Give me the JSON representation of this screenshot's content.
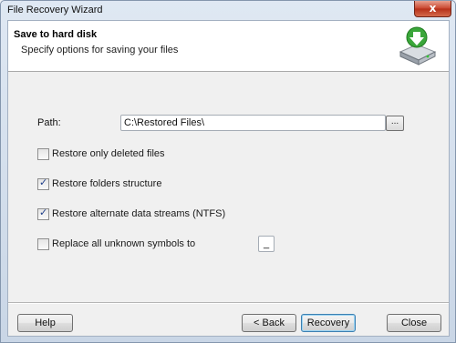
{
  "window": {
    "title": "File Recovery Wizard",
    "close_glyph": "x"
  },
  "header": {
    "title": "Save to hard disk",
    "subtitle": "Specify options for saving your files",
    "icon": "hard-disk-download-icon"
  },
  "path": {
    "label": "Path:",
    "value": "C:\\Restored Files\\",
    "browse_label": "..."
  },
  "options": [
    {
      "label": "Restore only deleted files",
      "checked": false
    },
    {
      "label": "Restore folders structure",
      "checked": true
    },
    {
      "label": "Restore alternate data streams (NTFS)",
      "checked": true
    },
    {
      "label": "Replace all unknown symbols to",
      "checked": false
    }
  ],
  "replace_symbol": "_",
  "buttons": {
    "help": "Help",
    "back": "< Back",
    "recovery": "Recovery",
    "close": "Close"
  },
  "colors": {
    "accent": "#3c7fb1",
    "close_red": "#c8442c",
    "icon_green": "#3aa63a"
  }
}
